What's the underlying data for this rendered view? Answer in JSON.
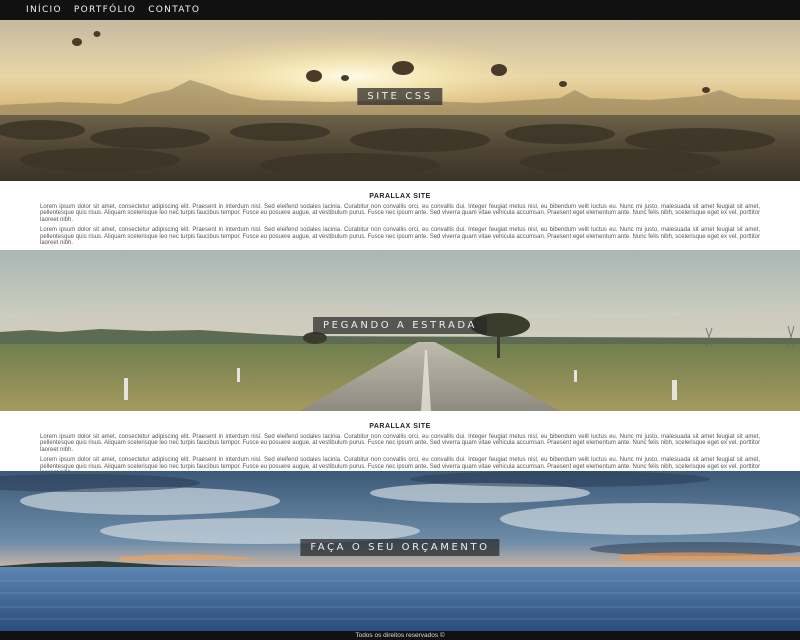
{
  "nav": {
    "items": [
      {
        "label": "INÍCIO"
      },
      {
        "label": "PORTFÓLIO"
      },
      {
        "label": "CONTATO"
      }
    ]
  },
  "sections": {
    "hero1_title": "SITE CSS",
    "hero2_title": "PEGANDO A ESTRADA",
    "hero3_title": "FAÇA O SEU ORÇAMENTO"
  },
  "text1": {
    "heading": "PARALLAX SITE",
    "p1": "Lorem ipsum dolor sit amet, consectetur adipiscing elit. Praesent in interdum nisl. Sed eleifend sodales lacinia. Curabitur non convallis orci, eu convallis dui. Integer feugiat metus nisl, eu bibendum velit luctus eu. Nunc mi justo, malesuada sit amet feugiat sit amet, pellentesque quis risus. Aliquam scelerisque leo nec turpis faucibus tempor. Fusce eu posuere augue, at vestibulum purus. Fusce nec ipsum ante. Sed viverra quam vitae vehicula accumsan. Praesent eget elementum ante. Nunc felis nibh, scelerisque eget ex vel, porttitor laoreet nibh.",
    "p2": "Lorem ipsum dolor sit amet, consectetur adipiscing elit. Praesent in interdum nisl. Sed eleifend sodales lacinia. Curabitur non convallis orci, eu convallis dui. Integer feugiat metus nisl, eu bibendum velit luctus eu. Nunc mi justo, malesuada sit amet feugiat sit amet, pellentesque quis risus. Aliquam scelerisque leo nec turpis faucibus tempor. Fusce eu posuere augue, at vestibulum purus. Fusce nec ipsum ante. Sed viverra quam vitae vehicula accumsan. Praesent eget elementum ante. Nunc felis nibh, scelerisque eget ex vel, porttitor laoreet nibh."
  },
  "text2": {
    "heading": "PARALLAX SITE",
    "p1": "Lorem ipsum dolor sit amet, consectetur adipiscing elit. Praesent in interdum nisl. Sed eleifend sodales lacinia. Curabitur non convallis orci, eu convallis dui. Integer feugiat metus nisl, eu bibendum velit luctus eu. Nunc mi justo, malesuada sit amet feugiat sit amet, pellentesque quis risus. Aliquam scelerisque leo nec turpis faucibus tempor. Fusce eu posuere augue, at vestibulum purus. Fusce nec ipsum ante. Sed viverra quam vitae vehicula accumsan. Praesent eget elementum ante. Nunc felis nibh, scelerisque eget ex vel, porttitor laoreet nibh.",
    "p2": "Lorem ipsum dolor sit amet, consectetur adipiscing elit. Praesent in interdum nisl. Sed eleifend sodales lacinia. Curabitur non convallis orci, eu convallis dui. Integer feugiat metus nisl, eu bibendum velit luctus eu. Nunc mi justo, malesuada sit amet feugiat sit amet, pellentesque quis risus. Aliquam scelerisque leo nec turpis faucibus tempor. Fusce eu posuere augue, at vestibulum purus. Fusce nec ipsum ante. Sed viverra quam vitae vehicula accumsan. Praesent eget elementum ante. Nunc felis nibh, scelerisque eget ex vel, porttitor laoreet nibh."
  },
  "footer": {
    "text": "Todos os direitos reservados ©"
  }
}
